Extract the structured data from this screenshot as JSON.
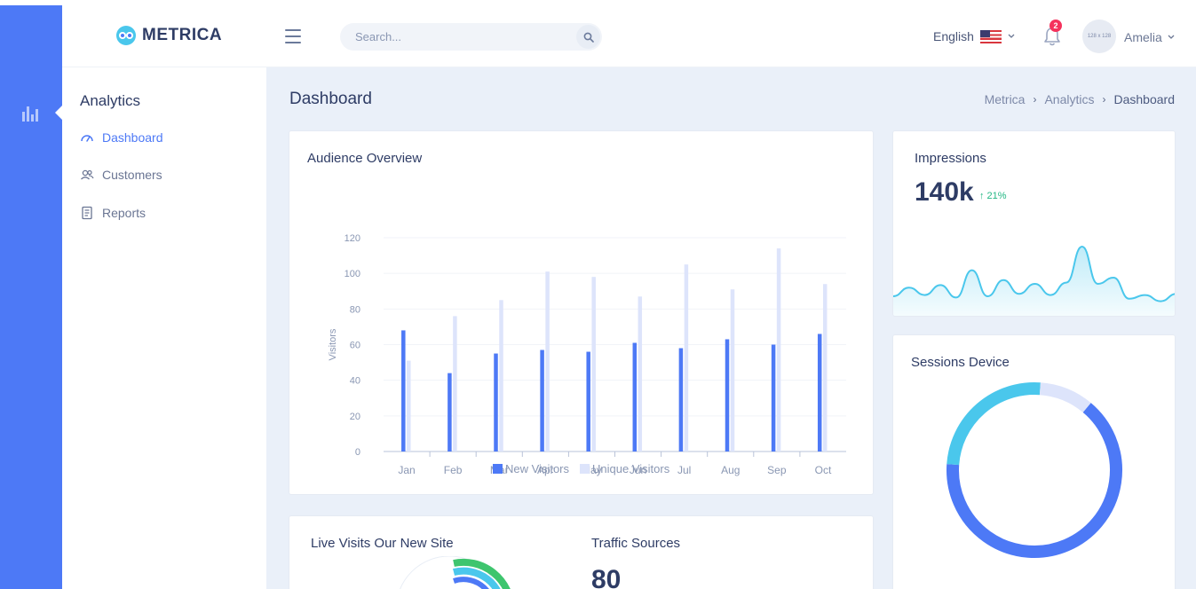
{
  "app": {
    "logo_text": "METRICA"
  },
  "topbar": {
    "search_placeholder": "Search...",
    "language": "English",
    "notification_count": "2",
    "avatar_text": "128 x 128",
    "user_name": "Amelia"
  },
  "sidebar": {
    "section_title": "Analytics",
    "items": [
      {
        "label": "Dashboard",
        "icon": "speedometer-icon",
        "active": true
      },
      {
        "label": "Customers",
        "icon": "users-icon",
        "active": false
      },
      {
        "label": "Reports",
        "icon": "document-icon",
        "active": false
      }
    ]
  },
  "page": {
    "title": "Dashboard",
    "breadcrumb": [
      "Metrica",
      "Analytics",
      "Dashboard"
    ]
  },
  "cards": {
    "audience_title": "Audience Overview",
    "impressions_title": "Impressions",
    "impressions_value": "140k",
    "impressions_change": "↑ 21%",
    "sessions_title": "Sessions Device",
    "live_title": "Live Visits Our New Site",
    "traffic_title": "Traffic Sources",
    "traffic_value": "80"
  },
  "colors": {
    "accent": "#4d79f6",
    "light_series": "#dde4fb",
    "cyan": "#4ac7ec",
    "positive": "#22b783",
    "badge": "#f5325c"
  },
  "chart_data": [
    {
      "type": "bar",
      "title": "Audience Overview",
      "xlabel": "",
      "ylabel": "Visitors",
      "ylim": [
        0,
        120
      ],
      "yticks": [
        0,
        20,
        40,
        60,
        80,
        100,
        120
      ],
      "categories": [
        "Jan",
        "Feb",
        "Mar",
        "Apr",
        "May",
        "Jun",
        "Jul",
        "Aug",
        "Sep",
        "Oct"
      ],
      "series": [
        {
          "name": "New Visitors",
          "color": "#4d79f6",
          "values": [
            68,
            44,
            55,
            57,
            56,
            61,
            58,
            63,
            60,
            66
          ]
        },
        {
          "name": "Unique Visitors",
          "color": "#dde4fb",
          "values": [
            51,
            76,
            85,
            101,
            98,
            87,
            105,
            91,
            114,
            94
          ]
        }
      ],
      "legend": "bottom"
    },
    {
      "type": "area",
      "title": "Impressions",
      "values": [
        20,
        34,
        22,
        38,
        18,
        62,
        20,
        46,
        24,
        40,
        22,
        42,
        100,
        40,
        50,
        16,
        22,
        12,
        24
      ]
    },
    {
      "type": "pie",
      "title": "Sessions Device",
      "donut": true,
      "slices": [
        {
          "value": 65,
          "color": "#4d79f6"
        },
        {
          "value": 25,
          "color": "#4ac7ec"
        },
        {
          "value": 10,
          "color": "#dde4fb"
        }
      ]
    }
  ]
}
